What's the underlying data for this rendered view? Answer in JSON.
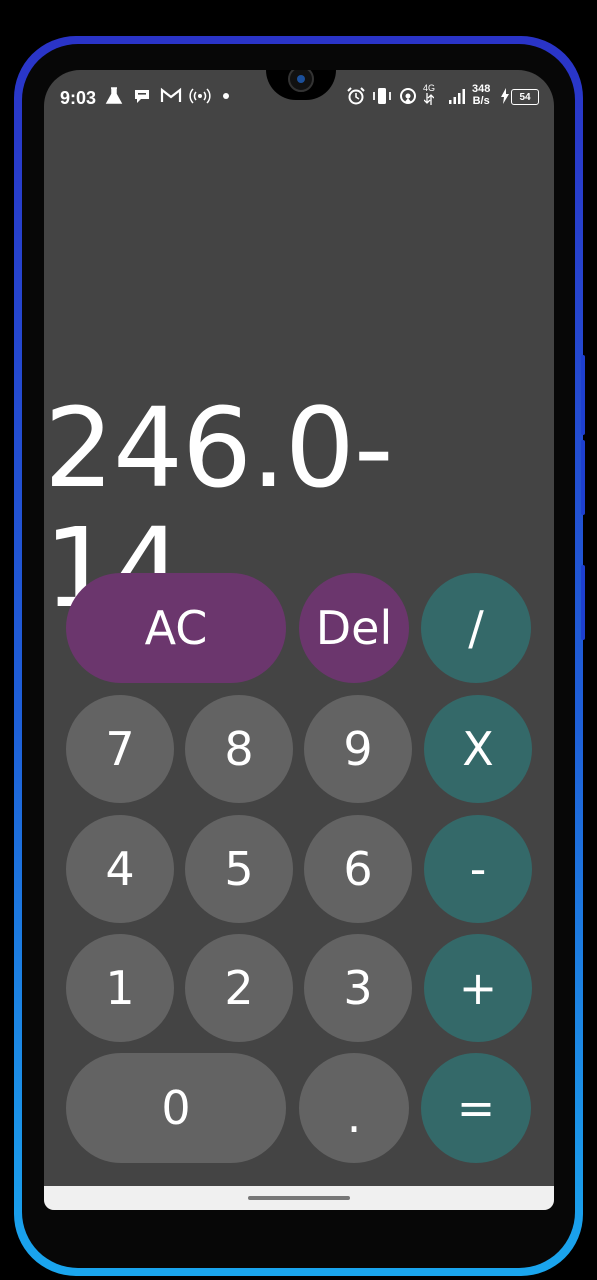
{
  "status_bar": {
    "time": "9:03",
    "net_speed_value": "348",
    "net_speed_unit": "B/s",
    "battery": "54",
    "network_type": "4G",
    "icons_left": [
      "flask-icon",
      "chat-bubble-icon",
      "gmail-icon",
      "hotspot-icon",
      "dot-icon"
    ],
    "icons_right": [
      "alarm-icon",
      "vibrate-icon",
      "location-icon",
      "signal-icon",
      "battery-icon"
    ]
  },
  "calculator": {
    "display": "246.0-14",
    "keys": {
      "clear": "AC",
      "delete": "Del",
      "divide": "/",
      "multiply": "X",
      "minus": "-",
      "plus": "+",
      "equals": "=",
      "decimal": ".",
      "d0": "0",
      "d1": "1",
      "d2": "2",
      "d3": "3",
      "d4": "4",
      "d5": "5",
      "d6": "6",
      "d7": "7",
      "d8": "8",
      "d9": "9"
    }
  },
  "colors": {
    "background": "#444444",
    "number_key": "#636363",
    "operator_key": "#346969",
    "function_key": "#6b366d",
    "frame_top": "#2a34c8",
    "frame_bottom": "#1aa6ee"
  }
}
